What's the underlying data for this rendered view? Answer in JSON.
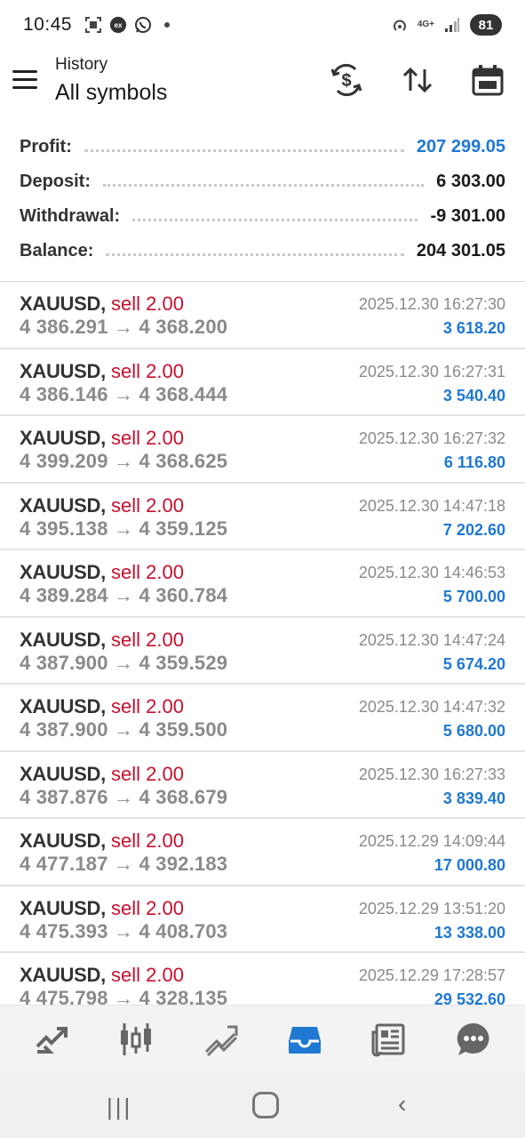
{
  "status_bar": {
    "time": "10:45",
    "left_icons": [
      "screenshot-icon",
      "exchange-app-icon",
      "whatsapp-icon"
    ],
    "network": "4G+",
    "battery": "81"
  },
  "header": {
    "subtitle": "History",
    "title": "All symbols",
    "actions": [
      "currency-exchange-icon",
      "sort-icon",
      "calendar-icon"
    ]
  },
  "summary": {
    "profit": {
      "label": "Profit:",
      "value": "207 299.05"
    },
    "deposit": {
      "label": "Deposit:",
      "value": "6 303.00"
    },
    "withdrawal": {
      "label": "Withdrawal:",
      "value": "-9 301.00"
    },
    "balance": {
      "label": "Balance:",
      "value": "204 301.05"
    }
  },
  "colors": {
    "profit_blue": "#1f78d1",
    "sell_red": "#c8102e",
    "active_nav": "#1f78d1"
  },
  "deals": [
    {
      "symbol": "XAUUSD,",
      "side": "sell 2.00",
      "open": "4 386.291",
      "arrow": "→",
      "close": "4 368.200",
      "time": "2025.12.30 16:27:30",
      "profit": "3 618.20"
    },
    {
      "symbol": "XAUUSD,",
      "side": "sell 2.00",
      "open": "4 386.146",
      "arrow": "→",
      "close": "4 368.444",
      "time": "2025.12.30 16:27:31",
      "profit": "3 540.40"
    },
    {
      "symbol": "XAUUSD,",
      "side": "sell 2.00",
      "open": "4 399.209",
      "arrow": "→",
      "close": "4 368.625",
      "time": "2025.12.30 16:27:32",
      "profit": "6 116.80"
    },
    {
      "symbol": "XAUUSD,",
      "side": "sell 2.00",
      "open": "4 395.138",
      "arrow": "→",
      "close": "4 359.125",
      "time": "2025.12.30 14:47:18",
      "profit": "7 202.60"
    },
    {
      "symbol": "XAUUSD,",
      "side": "sell 2.00",
      "open": "4 389.284",
      "arrow": "→",
      "close": "4 360.784",
      "time": "2025.12.30 14:46:53",
      "profit": "5 700.00"
    },
    {
      "symbol": "XAUUSD,",
      "side": "sell 2.00",
      "open": "4 387.900",
      "arrow": "→",
      "close": "4 359.529",
      "time": "2025.12.30 14:47:24",
      "profit": "5 674.20"
    },
    {
      "symbol": "XAUUSD,",
      "side": "sell 2.00",
      "open": "4 387.900",
      "arrow": "→",
      "close": "4 359.500",
      "time": "2025.12.30 14:47:32",
      "profit": "5 680.00"
    },
    {
      "symbol": "XAUUSD,",
      "side": "sell 2.00",
      "open": "4 387.876",
      "arrow": "→",
      "close": "4 368.679",
      "time": "2025.12.30 16:27:33",
      "profit": "3 839.40"
    },
    {
      "symbol": "XAUUSD,",
      "side": "sell 2.00",
      "open": "4 477.187",
      "arrow": "→",
      "close": "4 392.183",
      "time": "2025.12.29 14:09:44",
      "profit": "17 000.80"
    },
    {
      "symbol": "XAUUSD,",
      "side": "sell 2.00",
      "open": "4 475.393",
      "arrow": "→",
      "close": "4 408.703",
      "time": "2025.12.29 13:51:20",
      "profit": "13 338.00"
    },
    {
      "symbol": "XAUUSD,",
      "side": "sell 2.00",
      "open": "4 475.798",
      "arrow": "→",
      "close": "4 328.135",
      "time": "2025.12.29 17:28:57",
      "profit": "29 532.60"
    }
  ],
  "bottom_nav": {
    "items": [
      "quotes-icon",
      "chart-icon",
      "trade-icon",
      "history-icon",
      "news-icon",
      "messages-icon"
    ],
    "active": "history-icon"
  },
  "system_nav": {
    "recent": "|||",
    "back": "‹"
  }
}
